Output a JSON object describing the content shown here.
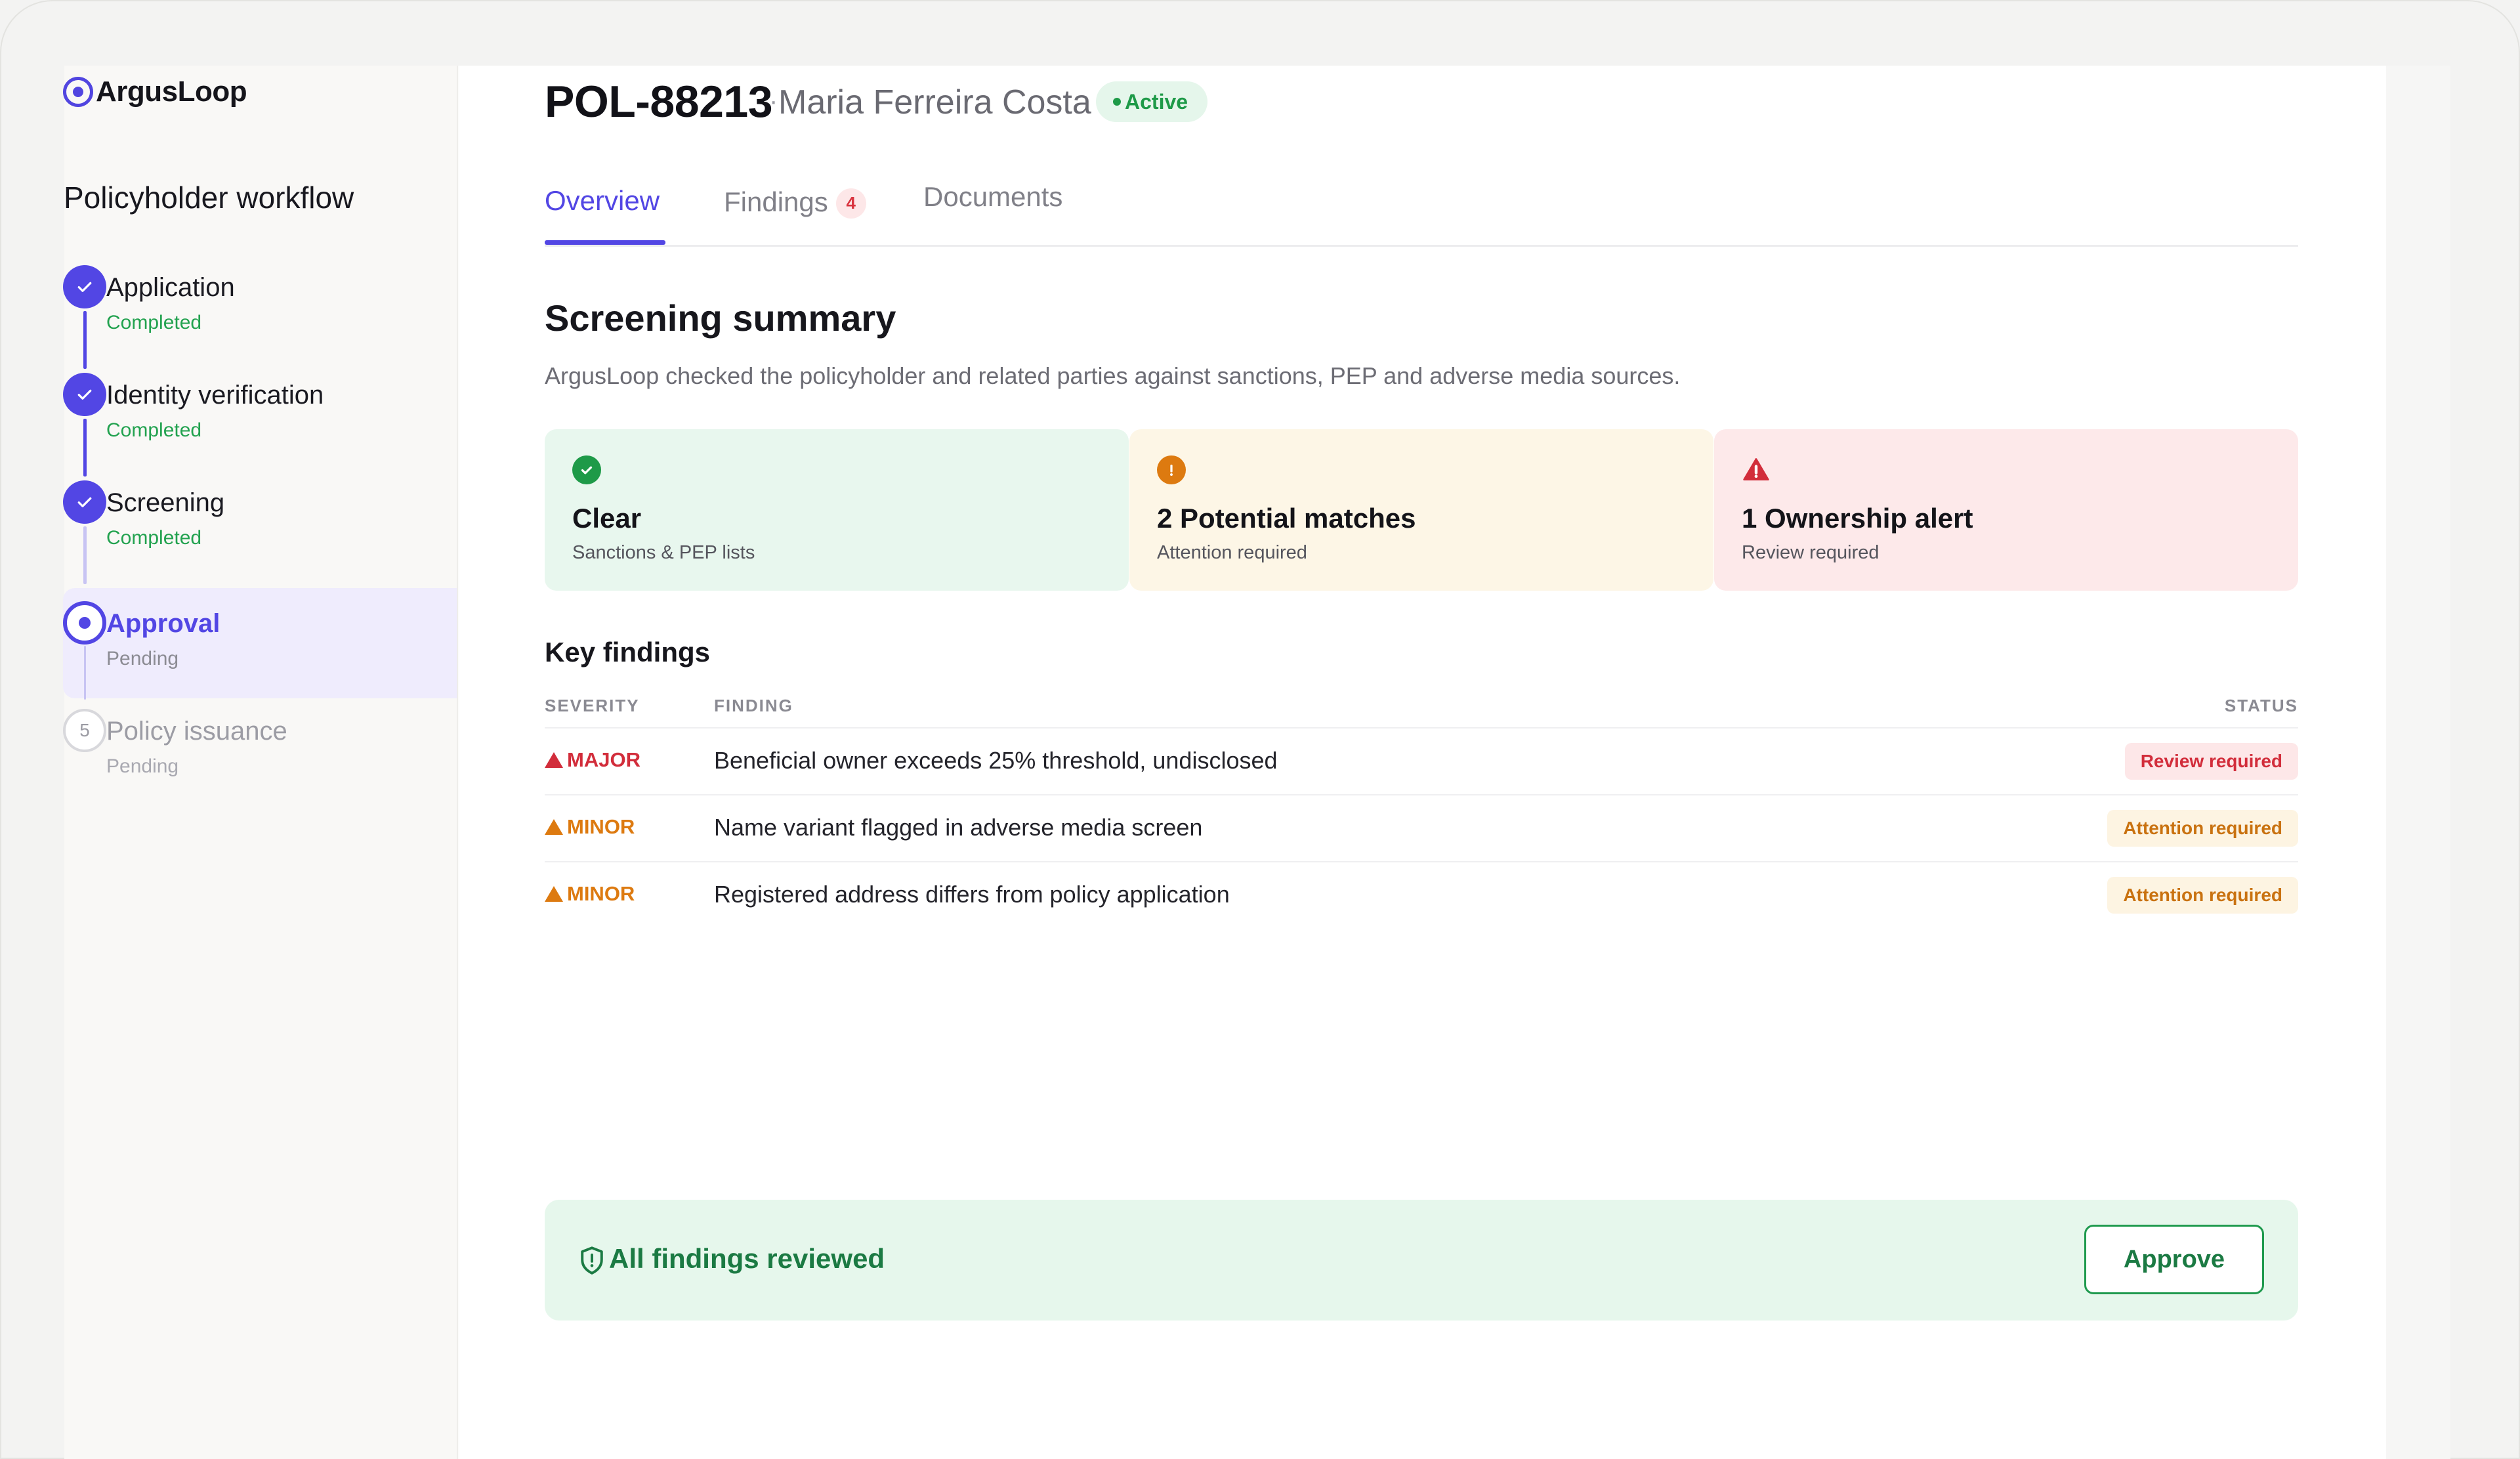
{
  "brand": {
    "name": "ArgusLoop",
    "icon": "target-dot-icon"
  },
  "sidebar": {
    "title": "Policyholder workflow",
    "steps": [
      {
        "label": "Application",
        "status": "Completed",
        "state": "done"
      },
      {
        "label": "Identity verification",
        "status": "Completed",
        "state": "done"
      },
      {
        "label": "Screening",
        "status": "Completed",
        "state": "done"
      },
      {
        "label": "Approval",
        "status": "Pending",
        "state": "current"
      },
      {
        "label": "Policy issuance",
        "status": "Pending",
        "state": "todo",
        "number": "5"
      }
    ]
  },
  "header": {
    "policy_id": "POL-88213",
    "separator": "·",
    "holder": "Maria Ferreira Costa",
    "badge": "Active"
  },
  "tabs": [
    {
      "label": "Overview",
      "active": true
    },
    {
      "label": "Findings",
      "count": "4"
    },
    {
      "label": "Documents"
    }
  ],
  "summary": {
    "title": "Screening summary",
    "description": "ArgusLoop checked the policyholder and related parties against sanctions, PEP and adverse media sources.",
    "cards": [
      {
        "title": "Clear",
        "subtitle": "Sanctions & PEP lists",
        "icon": "check-circle-icon",
        "color": "#1e9a48"
      },
      {
        "title": "2 Potential matches",
        "subtitle": "Attention required",
        "icon": "exclamation-circle-icon",
        "color": "#dd7a10"
      },
      {
        "title": "1 Ownership alert",
        "subtitle": "Review required",
        "icon": "warning-triangle-icon",
        "color": "#d22d3b"
      }
    ]
  },
  "findings": {
    "title": "Key findings",
    "columns": {
      "severity": "SEVERITY",
      "finding": "FINDING",
      "status": "STATUS"
    },
    "rows": [
      {
        "severity": "MAJOR",
        "finding": "Beneficial owner exceeds 25% threshold, undisclosed",
        "status": "Review required"
      },
      {
        "severity": "MINOR",
        "finding": "Name variant flagged in adverse media screen",
        "status": "Attention required"
      },
      {
        "severity": "MINOR",
        "finding": "Registered address differs from policy application",
        "status": "Attention required"
      }
    ]
  },
  "footer": {
    "message": "All findings reviewed",
    "icon": "shield-icon",
    "approve_label": "Approve"
  },
  "colors": {
    "accent": "#5246e4",
    "success": "#1e9a48",
    "warning": "#dd7a10",
    "danger": "#d22d3b"
  }
}
